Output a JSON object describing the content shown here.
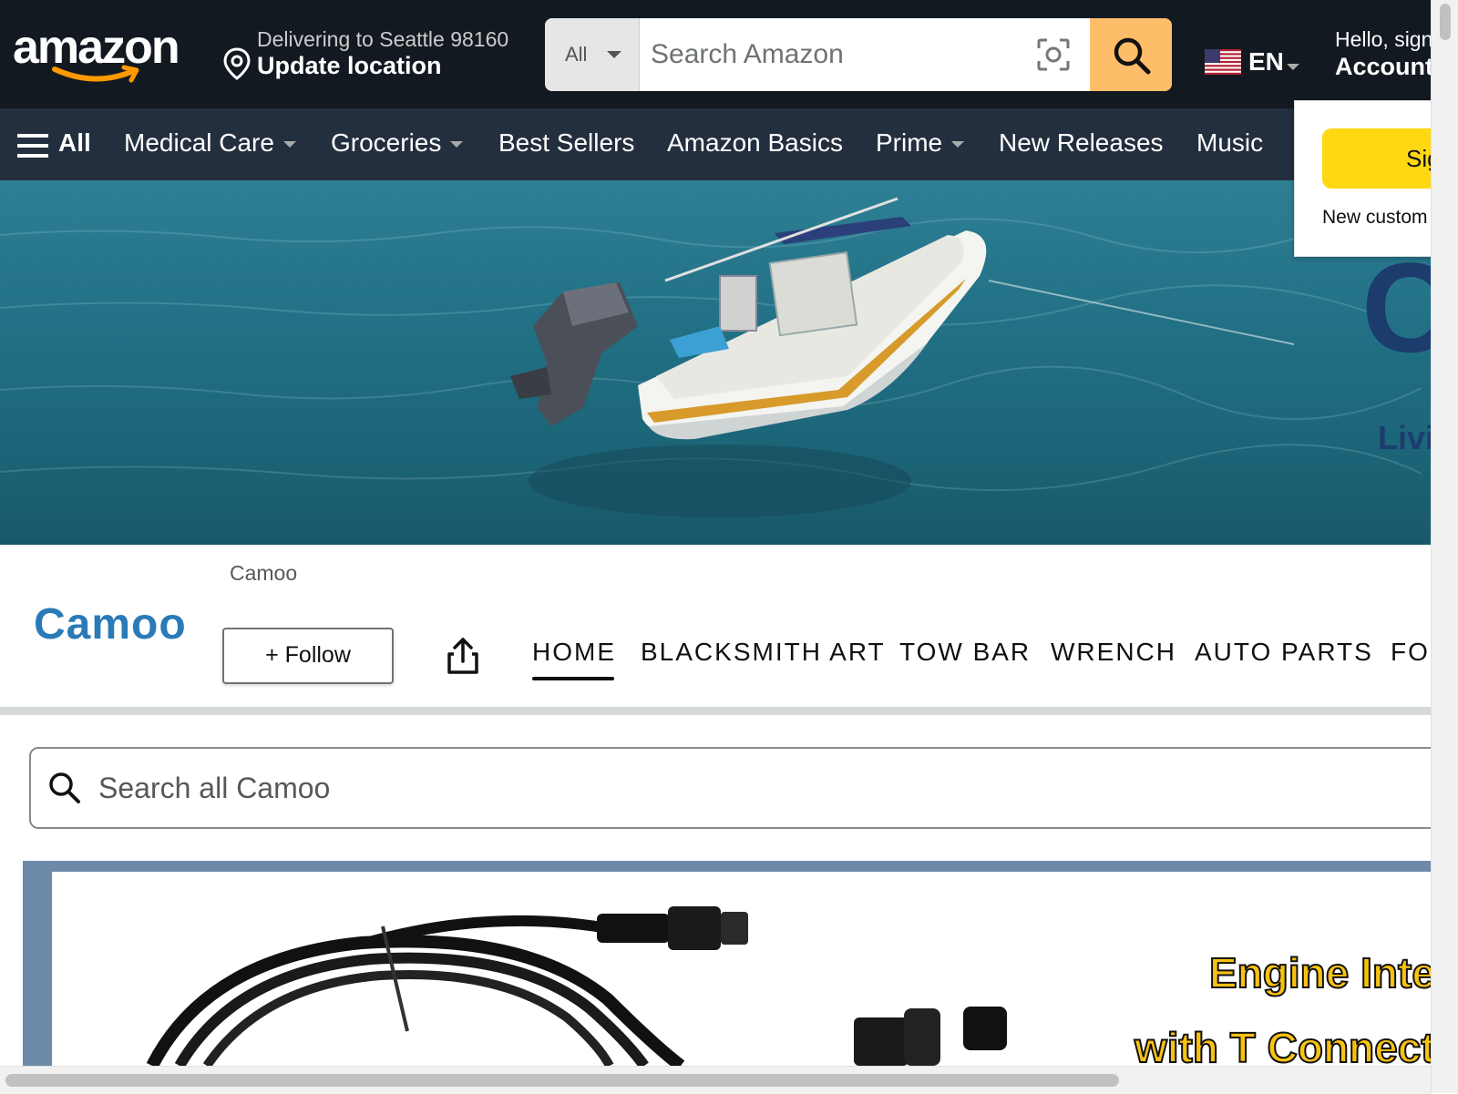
{
  "header": {
    "logo_text": "amazon",
    "deliver_line1": "Delivering to Seattle 98160",
    "deliver_line2": "Update location",
    "search_category": "All",
    "search_placeholder": "Search Amazon",
    "language": "EN",
    "account_line1": "Hello, sign",
    "account_line2": "Account"
  },
  "nav": {
    "all_label": "All",
    "items": [
      {
        "label": "Medical Care",
        "dropdown": true
      },
      {
        "label": "Groceries",
        "dropdown": true
      },
      {
        "label": "Best Sellers",
        "dropdown": false
      },
      {
        "label": "Amazon Basics",
        "dropdown": false
      },
      {
        "label": "Prime",
        "dropdown": true
      },
      {
        "label": "New Releases",
        "dropdown": false
      },
      {
        "label": "Music",
        "dropdown": false
      }
    ]
  },
  "flyout": {
    "signin_label": "Sig",
    "new_customer_text": "New custom"
  },
  "hero": {
    "brand_letter": "C",
    "tagline": "Livi"
  },
  "store": {
    "brand_name": "Camoo",
    "breadcrumb": "Camoo",
    "follow_label": "+ Follow",
    "tabs": [
      "HOME",
      "BLACKSMITH ART",
      "TOW BAR",
      "WRENCH",
      "AUTO PARTS",
      "FOR"
    ],
    "active_tab": "HOME",
    "search_placeholder": "Search all Camoo"
  },
  "promo": {
    "line1": "Engine Inter",
    "line2": "with T Connecto"
  },
  "colors": {
    "header_bg": "#131921",
    "nav_bg": "#232f3e",
    "search_button": "#febd69",
    "signin_button": "#ffd814",
    "brand_blue": "#2a7ab8",
    "promo_yellow": "#f8c213"
  }
}
